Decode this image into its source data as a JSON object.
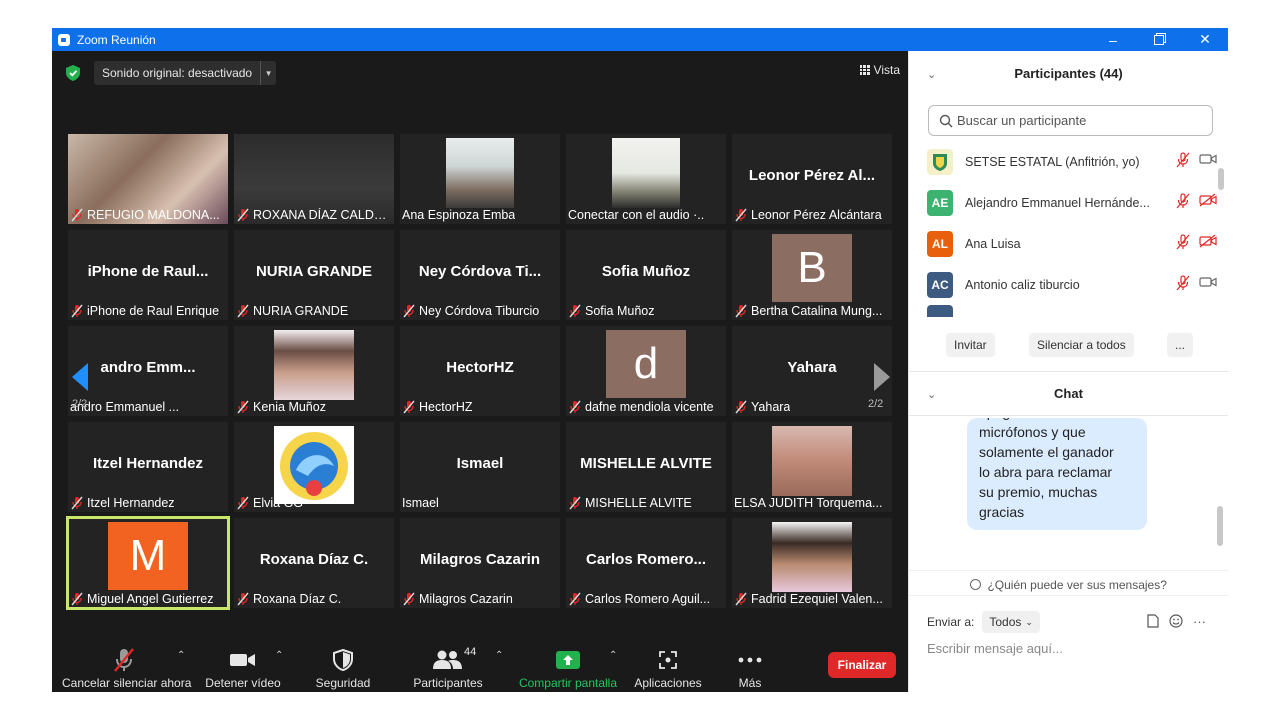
{
  "window": {
    "title": "Zoom Reunión"
  },
  "top": {
    "audio_label": "Sonido original: desactivado",
    "view_label": "Vista"
  },
  "tiles": [
    {
      "row": 0,
      "col": 0,
      "caption": "REFUGIO MALDONA...",
      "kind": "photo",
      "muted": true
    },
    {
      "row": 0,
      "col": 1,
      "caption": "ROXANA DÍAZ CALDE...",
      "kind": "blur",
      "muted": true
    },
    {
      "row": 0,
      "col": 2,
      "caption": "Ana Espinoza Emba",
      "kind": "photo",
      "muted": false
    },
    {
      "row": 0,
      "col": 3,
      "caption": "Conectar con el audio ·..",
      "kind": "photo",
      "muted": false
    },
    {
      "row": 0,
      "col": 4,
      "caption": "Leonor Pérez Alcántara",
      "kind": "name",
      "big": "Leonor Pérez Al...",
      "muted": true
    },
    {
      "row": 1,
      "col": 0,
      "caption": "iPhone de Raul Enrique",
      "kind": "name",
      "big": "iPhone  de  Raul...",
      "muted": true
    },
    {
      "row": 1,
      "col": 1,
      "caption": "NURIA GRANDE",
      "kind": "name",
      "big": "NURIA GRANDE",
      "muted": true
    },
    {
      "row": 1,
      "col": 2,
      "caption": "Ney Córdova Tiburcio",
      "kind": "name",
      "big": "Ney  Córdova  Ti...",
      "muted": true
    },
    {
      "row": 1,
      "col": 3,
      "caption": "Sofia Muñoz",
      "kind": "name",
      "big": "Sofia Muñoz",
      "muted": true
    },
    {
      "row": 1,
      "col": 4,
      "caption": "Bertha Catalina Mung...",
      "kind": "letter",
      "letter": "B",
      "color": "#8c6d62",
      "muted": true
    },
    {
      "row": 2,
      "col": 0,
      "caption": "andro Emmanuel ...",
      "kind": "name",
      "big": "andro  Emm...",
      "muted": false
    },
    {
      "row": 2,
      "col": 1,
      "caption": "Kenia Muñoz",
      "kind": "photo",
      "muted": true
    },
    {
      "row": 2,
      "col": 2,
      "caption": "HectorHZ",
      "kind": "name",
      "big": "HectorHZ",
      "muted": true
    },
    {
      "row": 2,
      "col": 3,
      "caption": "dafne mendiola vicente",
      "kind": "letter",
      "letter": "d",
      "color": "#8c6d62",
      "muted": true
    },
    {
      "row": 2,
      "col": 4,
      "caption": "Yahara",
      "kind": "name",
      "big": "Yahara",
      "muted": true
    },
    {
      "row": 3,
      "col": 0,
      "caption": "Itzel Hernandez",
      "kind": "name",
      "big": "Itzel Hernandez",
      "muted": true
    },
    {
      "row": 3,
      "col": 1,
      "caption": "Elvia GG",
      "kind": "logo",
      "muted": true
    },
    {
      "row": 3,
      "col": 2,
      "caption": "Ismael",
      "kind": "name",
      "big": "Ismael",
      "muted": false
    },
    {
      "row": 3,
      "col": 3,
      "caption": "MISHELLE ALVITE",
      "kind": "name",
      "big": "MISHELLE ALVITE",
      "muted": true
    },
    {
      "row": 3,
      "col": 4,
      "caption": "ELSA JUDITH Torquema...",
      "kind": "photo",
      "muted": false
    },
    {
      "row": 4,
      "col": 0,
      "caption": "Miguel Angel Gutierrez",
      "kind": "letter",
      "letter": "M",
      "color": "#f26322",
      "muted": true,
      "active": true
    },
    {
      "row": 4,
      "col": 1,
      "caption": "Roxana Díaz C.",
      "kind": "name",
      "big": "Roxana Díaz C.",
      "muted": true
    },
    {
      "row": 4,
      "col": 2,
      "caption": "Milagros Cazarin",
      "kind": "name",
      "big": "Milagros Cazarin",
      "muted": true
    },
    {
      "row": 4,
      "col": 3,
      "caption": "Carlos Romero Aguil...",
      "kind": "name",
      "big": "Carlos  Romero...",
      "muted": true
    },
    {
      "row": 4,
      "col": 4,
      "caption": "Fadrid Ezequiel Valen...",
      "kind": "photo",
      "muted": true
    }
  ],
  "pagination": {
    "left": "2/2",
    "right": "2/2"
  },
  "toolbar": {
    "unmute": "Cancelar silenciar ahora",
    "video": "Detener vídeo",
    "security": "Seguridad",
    "participants": "Participantes",
    "participants_count": "44",
    "share": "Compartir pantalla",
    "apps": "Aplicaciones",
    "more": "Más",
    "end": "Finalizar"
  },
  "participants_panel": {
    "title": "Participantes (44)",
    "search_placeholder": "Buscar un participante",
    "list": [
      {
        "initials": "",
        "name": "SETSE ESTATAL (Anfitrión, yo)",
        "color": "#f5f0c8",
        "video_off": false
      },
      {
        "initials": "AE",
        "name": "Alejandro Emmanuel Hernánde...",
        "color": "#3cb371",
        "video_off": true
      },
      {
        "initials": "AL",
        "name": "Ana Luisa",
        "color": "#e8600c",
        "video_off": true
      },
      {
        "initials": "AC",
        "name": "Antonio caliz tiburcio",
        "color": "#3d5a80",
        "video_off": false
      }
    ],
    "invite": "Invitar",
    "mute_all": "Silenciar a todos",
    "more": "..."
  },
  "chat": {
    "title": "Chat",
    "message_lines": [
      "apagados sus",
      "micrófonos y que",
      "solamente el ganador",
      "lo abra para reclamar",
      "su premio, muchas",
      "gracias"
    ],
    "who_can_see": "¿Quién puede ver sus mensajes?",
    "send_to_label": "Enviar a:",
    "send_to_value": "Todos",
    "input_placeholder": "Escribir mensaje aquí..."
  },
  "colors": {
    "titlebar": "#0e71eb",
    "active_border": "#c8e66a",
    "end": "#e02828",
    "share": "#22b14c",
    "mute_red": "#e02828"
  }
}
